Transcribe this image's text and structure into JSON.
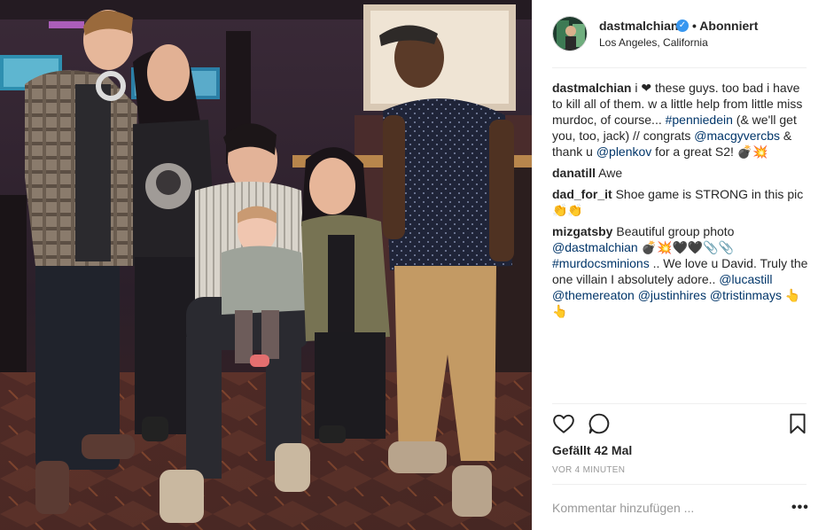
{
  "post": {
    "username": "dastmalchian",
    "verified_icon": "verified-badge-icon",
    "separator": "•",
    "follow_state": "Abonniert",
    "location": "Los Angeles, California",
    "photo_icon": "group-photo-image"
  },
  "comments": [
    {
      "user": "dastmalchian",
      "segments": [
        {
          "text": "i ",
          "tag": false
        },
        {
          "text": "❤",
          "tag": false
        },
        {
          "text": " these guys. too bad i have to kill all of them. w a little help from little miss murdoc, of course... ",
          "tag": false
        },
        {
          "text": "#penniedein",
          "tag": true
        },
        {
          "text": " (& we'll get you, too, jack) // congrats ",
          "tag": false
        },
        {
          "text": "@macgyvercbs",
          "tag": true
        },
        {
          "text": " & thank u ",
          "tag": false
        },
        {
          "text": "@plenkov",
          "tag": true
        },
        {
          "text": " for a great S2! 💣💥",
          "tag": false
        }
      ]
    },
    {
      "user": "danatill",
      "segments": [
        {
          "text": "Awe",
          "tag": false
        }
      ]
    },
    {
      "user": "dad_for_it",
      "segments": [
        {
          "text": "Shoe game is STRONG in this pic 👏👏",
          "tag": false
        }
      ]
    },
    {
      "user": "mizgatsby",
      "segments": [
        {
          "text": "Beautiful group photo ",
          "tag": false
        },
        {
          "text": "@dastmalchian",
          "tag": true
        },
        {
          "text": " 💣💥🖤🖤📎📎 ",
          "tag": false
        },
        {
          "text": "#murdocsminions",
          "tag": true
        },
        {
          "text": " .. We love u David. Truly the one villain I absolutely adore.. ",
          "tag": false
        },
        {
          "text": "@lucastill",
          "tag": true
        },
        {
          "text": " ",
          "tag": false
        },
        {
          "text": "@themereaton",
          "tag": true
        },
        {
          "text": " ",
          "tag": false
        },
        {
          "text": "@justinhires",
          "tag": true
        },
        {
          "text": " ",
          "tag": false
        },
        {
          "text": "@tristinmays",
          "tag": true
        },
        {
          "text": " 👆 👆",
          "tag": false
        }
      ]
    }
  ],
  "actions": {
    "like_icon": "heart-icon",
    "comment_icon": "comment-bubble-icon",
    "save_icon": "bookmark-icon",
    "likes": "Gefällt 42 Mal",
    "timestamp": "VOR 4 MINUTEN"
  },
  "comment_box": {
    "placeholder": "Kommentar hinzufügen ...",
    "more_label": "•••"
  },
  "colors": {
    "link": "#003569",
    "verified": "#3897f0",
    "meta": "#999999",
    "divider": "#efefef"
  }
}
